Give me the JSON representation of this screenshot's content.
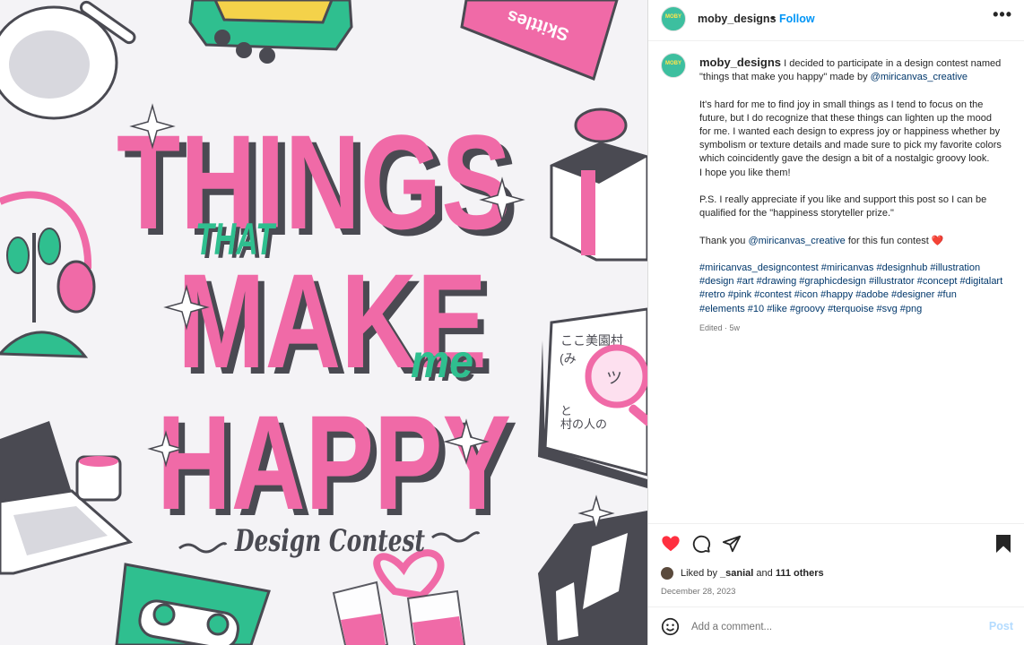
{
  "artwork": {
    "title_lines": [
      "THINGS",
      "THAT",
      "MAKE",
      "me",
      "HAPPY"
    ],
    "subtitle": "Design Contest",
    "candy_label": "Skittles",
    "book_text": [
      "ここ美園村",
      "(み",
      "ツ",
      "村の人の",
      "と"
    ],
    "colors": {
      "pink": "#f06aa7",
      "teal": "#2fbf8f",
      "dark": "#4a4a52",
      "bg": "#f4f3f6"
    }
  },
  "header": {
    "avatar_text": "MOBY",
    "username": "moby_designs",
    "separator": "•",
    "follow_label": "Follow",
    "more_icon": "more-horizontal-icon"
  },
  "caption": {
    "username": "moby_designs",
    "intro": "I decided to participate in a design contest named \"things that make you happy\" made by",
    "intro_mention": "@miricanvas_creative",
    "para1": "It's hard for me to find joy in small things as I tend to focus on the future, but I do recognize that these things can lighten up the mood for me. I wanted each design to express joy or happiness whether by symbolism or texture details and made sure to pick my favorite colors which coincidently gave the design a bit of a nostalgic groovy look.",
    "para1b": "I hope you like them!",
    "para2": "P.S. I really appreciate if you like and support this post so I can be qualified for the \"happiness storyteller prize.\"",
    "thanks_pre": "Thank you",
    "thanks_mention": "@miricanvas_creative",
    "thanks_post": "for this fun contest",
    "heart": "❤️",
    "hashtags": "#miricanvas_designcontest #miricanvas #designhub #illustration #design #art #drawing #graphicdesign #illustrator #concept #digitalart #retro #pink #contest #icon #happy #adobe #designer #fun #elements #10 #like #groovy #terquoise #svg #png",
    "edited": "Edited · 5w"
  },
  "actions": {
    "like_icon": "heart-filled-icon",
    "comment_icon": "comment-icon",
    "share_icon": "share-icon",
    "save_icon": "bookmark-filled-icon",
    "like_color": "#ff3040"
  },
  "likes": {
    "prefix": "Liked by",
    "user": "_sanial",
    "middle": "and",
    "count": "111 others"
  },
  "date": "December 28, 2023",
  "comment": {
    "placeholder": "Add a comment...",
    "post_label": "Post"
  }
}
